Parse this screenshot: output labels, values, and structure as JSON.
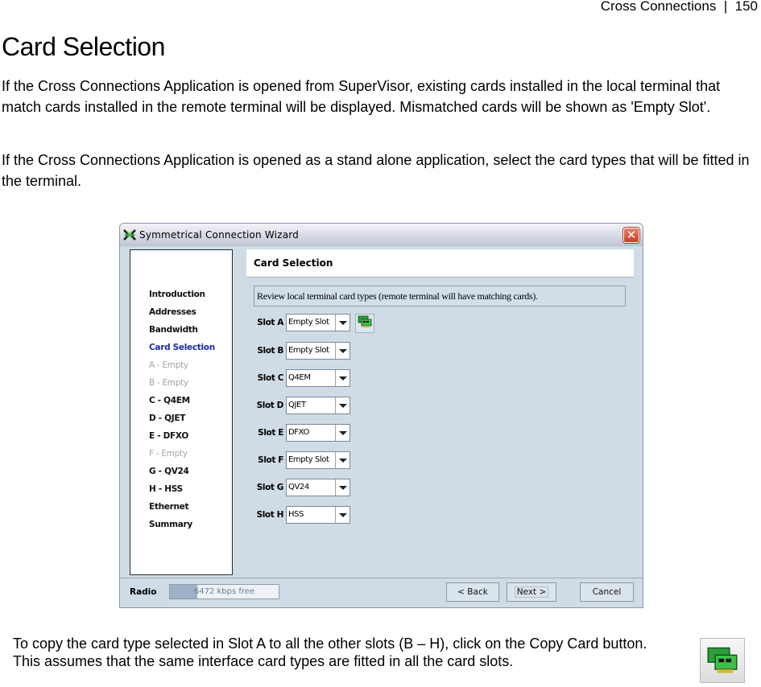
{
  "document": {
    "running_header": "Cross Connections  |  150",
    "title": "Card Selection",
    "paragraphs": [
      "If the Cross Connections Application is opened from SuperVisor, existing cards installed in the local terminal that match cards installed in the remote terminal will be displayed. Mismatched cards will be shown as 'Empty Slot'.",
      "If the Cross Connections Application is opened as a stand alone application, select the card types that will be fitted in the terminal."
    ],
    "copy_note": "To copy the card type selected in Slot A to all the other slots (B – H), click on the Copy Card button. This assumes that the same interface card types are fitted in all the card slots.",
    "copy_icon": "copy-card-icon"
  },
  "window": {
    "title": "Symmetrical Connection Wizard",
    "app_icon": "wizard-x-icon",
    "close_icon": "close-icon",
    "nav": {
      "items": [
        {
          "label": "Introduction",
          "state": "normal"
        },
        {
          "label": "Addresses",
          "state": "normal"
        },
        {
          "label": "Bandwidth",
          "state": "normal"
        },
        {
          "label": "Card Selection",
          "state": "current"
        },
        {
          "label": "A - Empty",
          "state": "disabled"
        },
        {
          "label": "B - Empty",
          "state": "disabled"
        },
        {
          "label": "C - Q4EM",
          "state": "normal"
        },
        {
          "label": "D - QJET",
          "state": "normal"
        },
        {
          "label": "E - DFXO",
          "state": "normal"
        },
        {
          "label": "F - Empty",
          "state": "disabled"
        },
        {
          "label": "G - QV24",
          "state": "normal"
        },
        {
          "label": "H - HSS",
          "state": "normal"
        },
        {
          "label": "Ethernet",
          "state": "normal"
        },
        {
          "label": "Summary",
          "state": "normal"
        }
      ]
    },
    "page_header": "Card Selection",
    "info_text": "Review local terminal card types (remote terminal will have matching cards).",
    "slots": [
      {
        "label": "Slot A",
        "value": "Empty Slot"
      },
      {
        "label": "Slot B",
        "value": "Empty Slot"
      },
      {
        "label": "Slot C",
        "value": "Q4EM"
      },
      {
        "label": "Slot D",
        "value": "QJET"
      },
      {
        "label": "Slot E",
        "value": "DFXO"
      },
      {
        "label": "Slot F",
        "value": "Empty Slot"
      },
      {
        "label": "Slot G",
        "value": "QV24"
      },
      {
        "label": "Slot H",
        "value": "HSS"
      }
    ],
    "copy_card_button_icon": "copy-card-icon",
    "footer": {
      "radio_label": "Radio",
      "radio_status": "6472 kbps free",
      "radio_used_fraction": 0.25,
      "back_label": "< Back",
      "next_label": "Next >",
      "cancel_label": "Cancel"
    },
    "colors": {
      "window_bg": "#cfdce6",
      "current_nav": "#1d2aa0",
      "disabled_nav": "#a4a4a4",
      "close_button": "#c83d22"
    }
  }
}
